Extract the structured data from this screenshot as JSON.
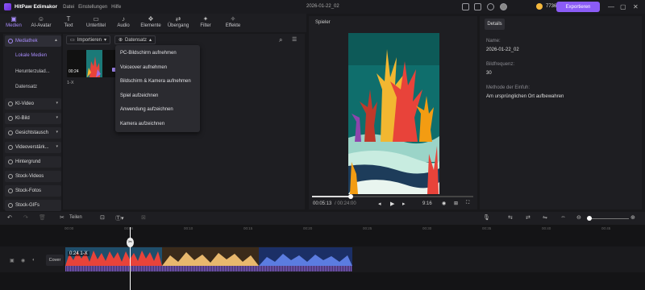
{
  "app": {
    "name": "HitPaw Edimakor",
    "project_title": "2026-01-22_02"
  },
  "menu": [
    "Datei",
    "Einstellungen",
    "Hilfe"
  ],
  "credits": "773653",
  "export_label": "Exportieren",
  "toolbar": [
    {
      "label": "Medien",
      "icon": "folder-icon",
      "glyph": "▣",
      "active": true
    },
    {
      "label": "AI-Avatar",
      "icon": "avatar-icon",
      "glyph": "☺",
      "active": false
    },
    {
      "label": "Text",
      "icon": "text-icon",
      "glyph": "T",
      "active": false
    },
    {
      "label": "Untertitel",
      "icon": "subtitle-icon",
      "glyph": "▭",
      "active": false
    },
    {
      "label": "Audio",
      "icon": "music-icon",
      "glyph": "♪",
      "active": false
    },
    {
      "label": "Elemente",
      "icon": "elements-icon",
      "glyph": "❖",
      "active": false
    },
    {
      "label": "Übergang",
      "icon": "transition-icon",
      "glyph": "⇄",
      "active": false
    },
    {
      "label": "Filter",
      "icon": "filter-icon",
      "glyph": "✦",
      "active": false
    },
    {
      "label": "Effekte",
      "icon": "effects-icon",
      "glyph": "✧",
      "active": false
    }
  ],
  "sidebar": {
    "mediathek": "Mediathek",
    "subitems": [
      "Lokale Medien",
      "Herunterzulad...",
      "Datensatz"
    ],
    "items": [
      "KI-Video",
      "KI-Bild",
      "Gesichtstausch",
      "Videoverstärk...",
      "Hintergrund",
      "Stock-Videos",
      "Stock-Fotos",
      "Stock-GIFs"
    ]
  },
  "media": {
    "import_label": "Importieren",
    "dataset_label": "Datensatz",
    "clip_duration": "00:24",
    "clip_name": "1-X"
  },
  "dropdown": [
    "PC-Bildschirm aufnehmen",
    "Voiceover aufnehmen",
    "Bildschirm & Kamera aufnehmen",
    "Spiel aufzeichnen",
    "Anwendung aufzeichnen",
    "Kamera aufzeichnen"
  ],
  "player": {
    "title": "Spieler",
    "current_time": "00:05:13",
    "total_time": "/ 00:24:00",
    "aspect": "9:16",
    "progress": 0.24
  },
  "details": {
    "tab": "Details",
    "name_label": "Name:",
    "name_value": "2026-01-22_02",
    "fps_label": "Bildfrequenz:",
    "fps_value": "30",
    "method_label": "Methode der Einfuh:",
    "method_value": "Am ursprünglichen Ort aufbewahren"
  },
  "timeline": {
    "split_label": "Teilen",
    "ruler": [
      "00:00",
      "00:05",
      "00:10",
      "00:15",
      "00:20",
      "00:25",
      "00:30",
      "00:35",
      "00:40",
      "00:45"
    ],
    "cover_label": "Cover",
    "clip_label": "0:24 1-X"
  },
  "colors": {
    "accent": "#8b5cf6",
    "bg": "#18181b",
    "panel": "#1e1e22"
  }
}
